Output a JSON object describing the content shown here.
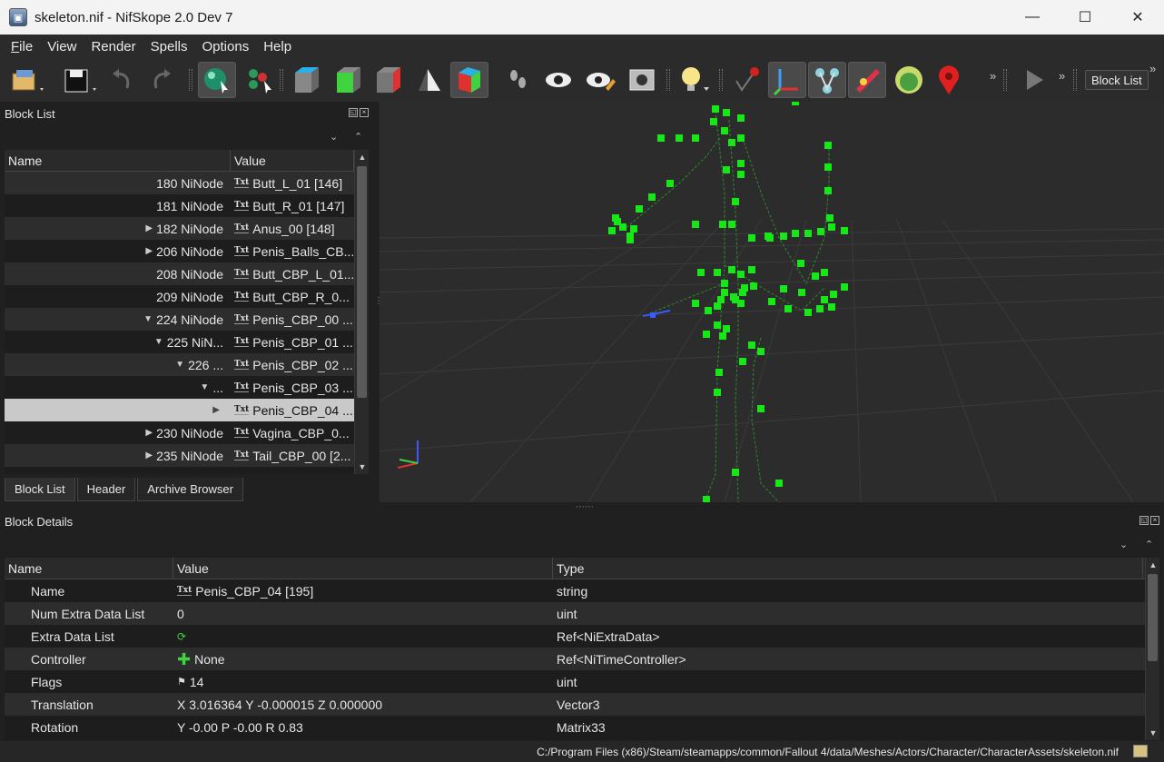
{
  "window": {
    "title": "skeleton.nif - NifSkope 2.0 Dev 7",
    "minimize_glyph": "—",
    "maximize_glyph": "☐",
    "close_glyph": "✕"
  },
  "menu": [
    {
      "label": "File",
      "accel": "F",
      "rest": "ile"
    },
    {
      "label": "View"
    },
    {
      "label": "Render"
    },
    {
      "label": "Spells"
    },
    {
      "label": "Options"
    },
    {
      "label": "Help"
    }
  ],
  "toolbar": {
    "more_glyph": "»",
    "block_list_button": "Block List",
    "icons": [
      "load-icon",
      "save-icon",
      "undo-icon",
      "redo-icon",
      "select-object-icon",
      "select-vertex-icon",
      "view-top-icon",
      "view-front-icon",
      "view-side-icon",
      "view-walk-icon",
      "view-user-icon",
      "walk-mode-icon",
      "view-eye-icon",
      "view-eye-edit-icon",
      "screenshot-icon",
      "light-icon",
      "pick-icon",
      "show-axes-icon",
      "show-nodes-icon",
      "show-constraints-icon",
      "show-markers-icon",
      "show-havok-icon",
      "show-marker-pin-icon",
      "play-icon"
    ]
  },
  "block_list": {
    "title": "Block List",
    "columns": [
      "Name",
      "Value"
    ],
    "rows": [
      {
        "name": "180 NiNode",
        "arrow": "",
        "value": "Butt_L_01 [146]"
      },
      {
        "name": "181 NiNode",
        "arrow": "",
        "value": "Butt_R_01 [147]"
      },
      {
        "name": "182 NiNode",
        "arrow": "▶",
        "value": "Anus_00 [148]"
      },
      {
        "name": "206 NiNode",
        "arrow": "▶",
        "value": "Penis_Balls_CB..."
      },
      {
        "name": "208 NiNode",
        "arrow": "",
        "value": "Butt_CBP_L_01..."
      },
      {
        "name": "209 NiNode",
        "arrow": "",
        "value": "Butt_CBP_R_0..."
      },
      {
        "name": "224 NiNode",
        "arrow": "▼",
        "value": "Penis_CBP_00 ..."
      },
      {
        "name": "225 NiN...",
        "arrow": "▼",
        "value": "Penis_CBP_01 ..."
      },
      {
        "name": "226 ...",
        "arrow": "▼",
        "value": "Penis_CBP_02 ..."
      },
      {
        "name": "...",
        "arrow": "▼",
        "value": "Penis_CBP_03 ..."
      },
      {
        "name": "",
        "arrow": "▶",
        "value": "Penis_CBP_04 ..."
      },
      {
        "name": "230 NiNode",
        "arrow": "▶",
        "value": "Vagina_CBP_0..."
      },
      {
        "name": "235 NiNode",
        "arrow": "▶",
        "value": "Tail_CBP_00 [2..."
      }
    ],
    "selected_index": 10,
    "txt_icon_label": "Txt",
    "tabs": [
      "Block List",
      "Header",
      "Archive Browser"
    ],
    "active_tab": 0
  },
  "block_details": {
    "title": "Block Details",
    "columns": [
      "Name",
      "Value",
      "Type"
    ],
    "rows": [
      {
        "name": "Name",
        "icon": "txt",
        "value": "Penis_CBP_04 [195]",
        "type": "string"
      },
      {
        "name": "Num Extra Data List",
        "icon": "",
        "value": "0",
        "type": "uint"
      },
      {
        "name": "Extra Data List",
        "icon": "refresh",
        "value": "",
        "type": "Ref<NiExtraData>"
      },
      {
        "name": "Controller",
        "icon": "plus",
        "value": "None",
        "type": "Ref<NiTimeController>"
      },
      {
        "name": "Flags",
        "icon": "flag",
        "value": "14",
        "type": "uint"
      },
      {
        "name": "Translation",
        "icon": "",
        "value": "X 3.016364 Y -0.000015 Z 0.000000",
        "type": "Vector3"
      },
      {
        "name": "Rotation",
        "icon": "",
        "value": "Y -0.00 P -0.00 R 0.83",
        "type": "Matrix33"
      }
    ]
  },
  "status": {
    "path": "C:/Program Files (x86)/Steam/steamapps/common/Fallout 4/data/Meshes/Actors/Character/CharacterAssets/skeleton.nif"
  }
}
